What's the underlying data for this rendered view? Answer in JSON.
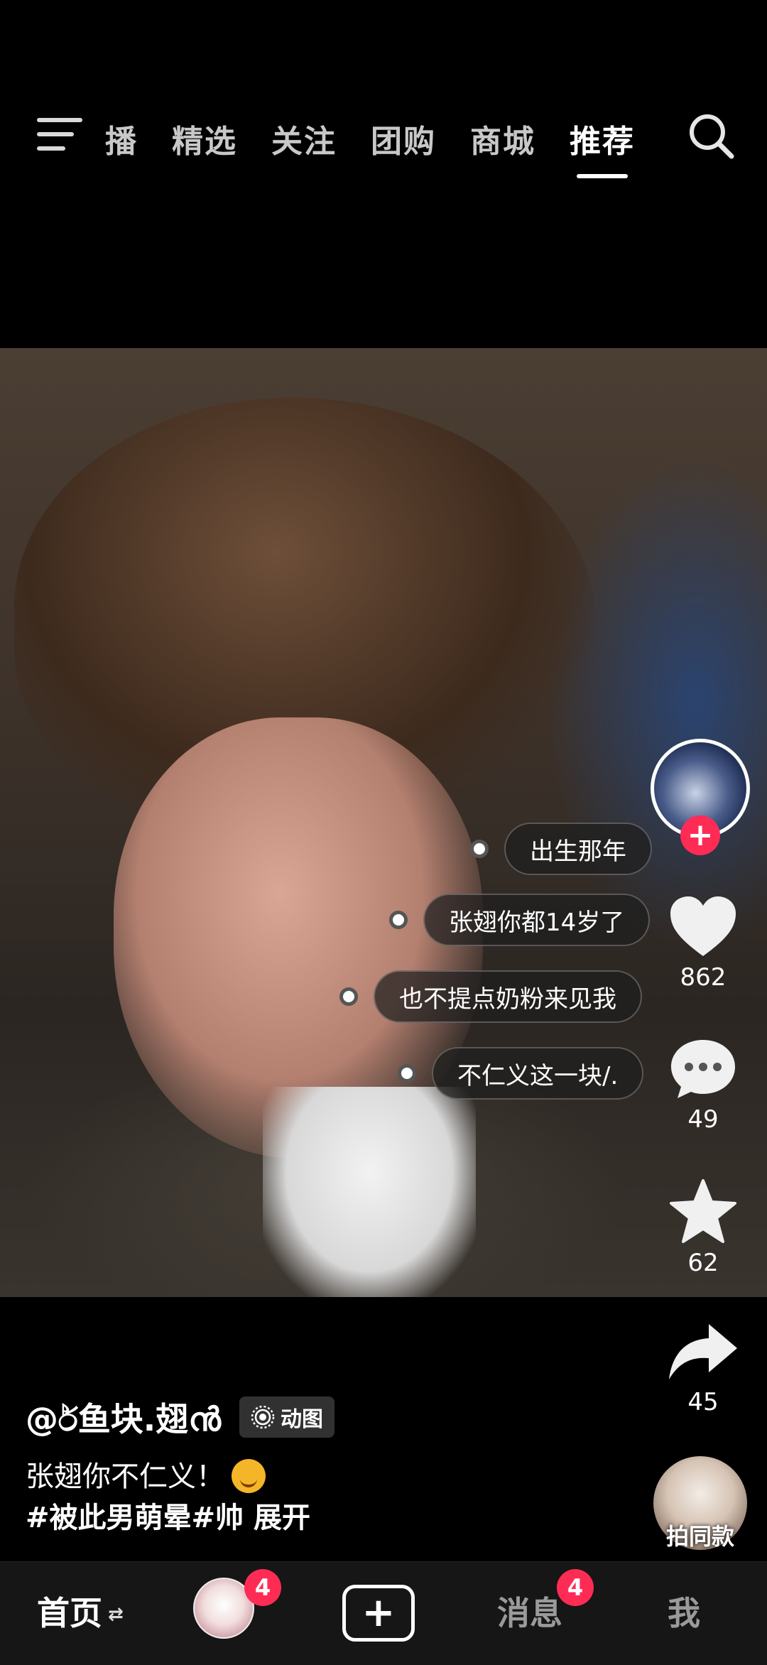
{
  "top_nav": {
    "tabs": [
      {
        "label": "播"
      },
      {
        "label": "精选"
      },
      {
        "label": "关注"
      },
      {
        "label": "团购"
      },
      {
        "label": "商城"
      },
      {
        "label": "推荐"
      }
    ],
    "active_tab": "推荐",
    "left_icon": "menu-icon",
    "right_icon": "search-icon"
  },
  "video": {
    "danmu": [
      {
        "text": "出生那年"
      },
      {
        "text": "张翅你都14岁了"
      },
      {
        "text": "也不提点奶粉来见我"
      },
      {
        "text": "不仁义这一块/."
      }
    ]
  },
  "right_rail": {
    "follow_symbol": "+",
    "like_count": "862",
    "comment_count": "49",
    "favorite_count": "62",
    "share_count": "45",
    "same_style_label": "拍同款"
  },
  "post": {
    "author": "@ර්鱼块.翅ൻ",
    "badge_label": "动图",
    "caption": "张翅你不仁义！",
    "hashtags": "#被此男萌晕#帅",
    "expand_label": "展开"
  },
  "bottom_nav": {
    "home_label": "首页",
    "home_arrows": "⇄",
    "friend_badge": "4",
    "create_symbol": "+",
    "messages_label": "消息",
    "messages_badge": "4",
    "me_label": "我"
  },
  "colors": {
    "accent": "#fe2c55",
    "background": "#000000",
    "bottom_bar": "#161616"
  }
}
